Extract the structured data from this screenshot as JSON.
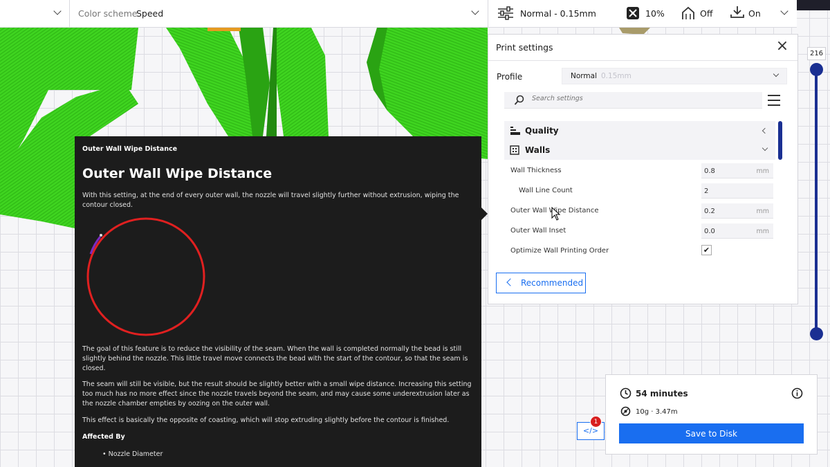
{
  "topbar": {
    "color_scheme_label": "Color scheme",
    "color_scheme_value": "Speed",
    "profile_summary": "Normal - 0.15mm",
    "infill_value": "10%",
    "support_value": "Off",
    "adhesion_value": "On"
  },
  "print_settings": {
    "title": "Print settings",
    "close_glyph": "×",
    "profile_label": "Profile",
    "profile_value": "Normal",
    "profile_sub": "0.15mm",
    "search_placeholder": "Search settings",
    "categories": [
      {
        "label": "Quality",
        "expanded": false
      },
      {
        "label": "Walls",
        "expanded": true
      }
    ],
    "settings": [
      {
        "label": "Wall Thickness",
        "value": "0.8",
        "unit": "mm"
      },
      {
        "label": "Wall Line Count",
        "value": "2",
        "unit": ""
      },
      {
        "label": "Outer Wall Wipe Distance",
        "value": "0.2",
        "unit": "mm"
      },
      {
        "label": "Outer Wall Inset",
        "value": "0.0",
        "unit": "mm"
      },
      {
        "label": "Optimize Wall Printing Order",
        "checked": true,
        "check_glyph": "✔"
      }
    ],
    "recommended_label": "Recommended"
  },
  "tooltip": {
    "small_title": "Outer Wall Wipe Distance",
    "title": "Outer Wall Wipe Distance",
    "intro": "With this setting, at the end of every outer wall, the nozzle will travel slightly further without extrusion, wiping the contour closed.",
    "para1": "The goal of this feature is to reduce the visibility of the seam. When the wall is completed normally the bead is still slightly behind the nozzle. This little travel move connects the bead with the start of the contour, so that the seam is closed.",
    "para2": "The seam will still be visible, but the result should be slightly better with a small wipe distance. Increasing this setting too much has no more effect since the nozzle travels beyond the seam, and may cause some underextrusion later as the nozzle chamber empties by oozing on the outer wall.",
    "para3": "This effect is basically the opposite of coasting, which will stop extruding slightly before the contour is finished.",
    "affected_by_label": "Affected By",
    "affected_item": "• Nozzle Diameter"
  },
  "layer_slider": {
    "layer_number": "216"
  },
  "print_result": {
    "time": "54 minutes",
    "material": "10g · 3.47m",
    "save_label": "Save to Disk"
  },
  "preview_button": {
    "glyph": "</>",
    "badge_count": "1"
  },
  "colors": {
    "accent": "#196ef0",
    "slider": "#1a2f92",
    "model_green": "#3cd21e",
    "tooltip_bg": "#1c1c1c",
    "badge": "#d81f1f",
    "wipe_circle": "#e02020",
    "wipe_segment": "#7a2cc0"
  }
}
